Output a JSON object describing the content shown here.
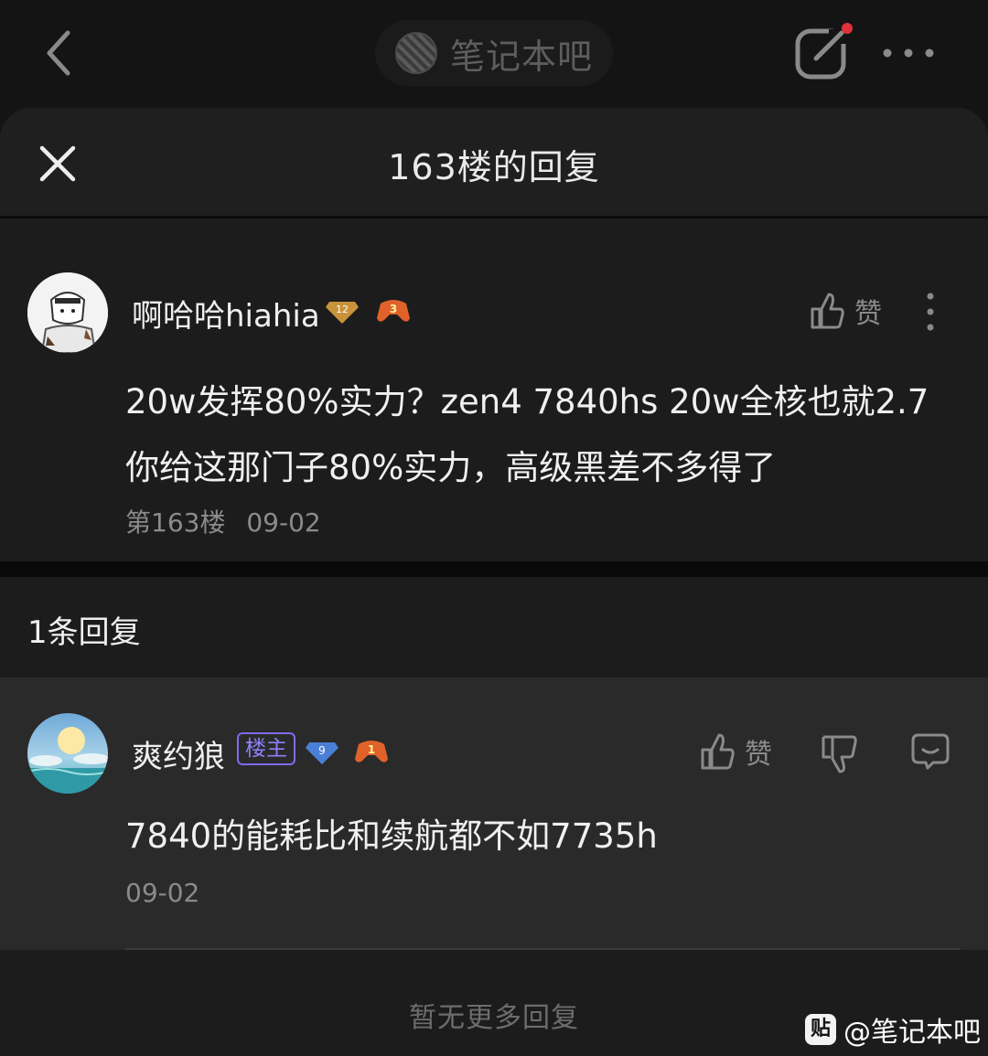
{
  "topbar": {
    "forum_name": "笔记本吧",
    "back_icon": "chevron-left-icon",
    "edit_icon": "edit-icon",
    "more_icon": "more-horizontal-icon",
    "notification_color": "#e0303a"
  },
  "sheet": {
    "title": "163楼的回复",
    "close_icon": "close-icon"
  },
  "main_post": {
    "username": "啊哈哈hiahia",
    "level": "12",
    "game_level": "3",
    "like_label": "赞",
    "text_line1": "20w发挥80%实力？zen4 7840hs 20w全核也就2.7",
    "text_line2": "你给这那门子80%实力，高级黑差不多得了",
    "floor": "第163楼",
    "date": "09-02"
  },
  "replies_section": {
    "count_label": "1条回复"
  },
  "reply": {
    "username": "爽约狼",
    "op_badge": "楼主",
    "level": "9",
    "game_level": "1",
    "like_label": "赞",
    "text": "7840的能耗比和续航都不如7735h",
    "date": "09-02"
  },
  "footer": {
    "no_more": "暂无更多回复"
  },
  "watermark": {
    "logo": "贴",
    "text": "@笔记本吧"
  },
  "colors": {
    "background": "#141414",
    "sheet": "#1c1c1c",
    "reply_bg": "#2a2a2a",
    "op_badge": "#7d6cf0",
    "level_badge_gold": "#c9933a",
    "level_badge_blue": "#4a7fd6",
    "game_badge": "#e0622a"
  }
}
